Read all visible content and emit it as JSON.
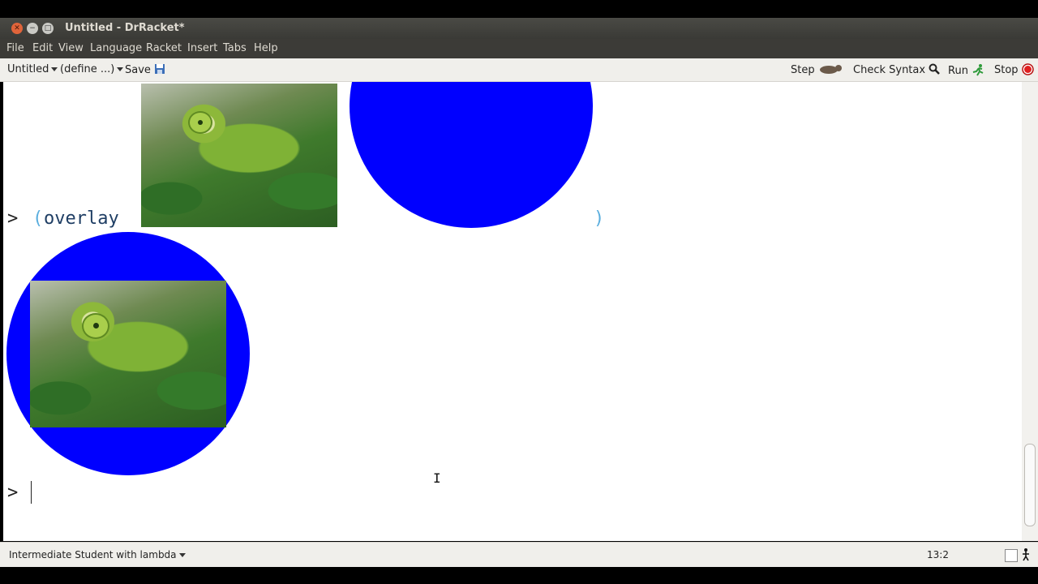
{
  "window": {
    "title": "Untitled - DrRacket*"
  },
  "menu": [
    "File",
    "Edit",
    "View",
    "Language",
    "Racket",
    "Insert",
    "Tabs",
    "Help"
  ],
  "toolbar": {
    "file_dropdown": "Untitled",
    "define_dropdown": "(define ...)",
    "save_label": "Save",
    "step_label": "Step",
    "check_syntax_label": "Check Syntax",
    "run_label": "Run",
    "stop_label": "Stop"
  },
  "repl": {
    "prompt": ">",
    "open_paren": "(",
    "function": "overlay",
    "close_paren": ")",
    "second_prompt": ">"
  },
  "colors": {
    "circle": "#0000ff",
    "paren": "#5aaede",
    "stop": "#e02020"
  },
  "status": {
    "language": "Intermediate Student with lambda",
    "position": "13:2"
  }
}
